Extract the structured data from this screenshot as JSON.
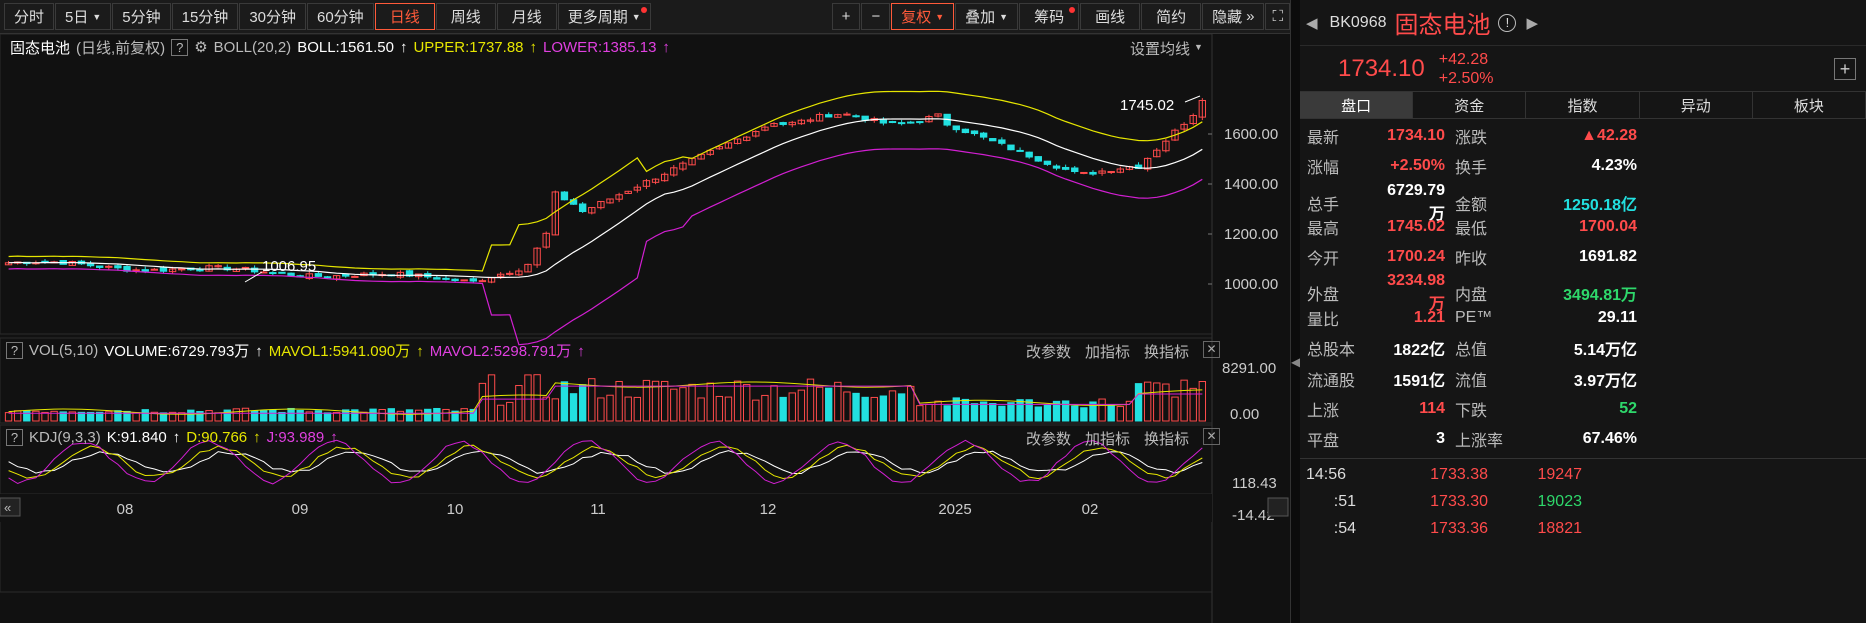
{
  "toolbar": {
    "periods": [
      "分时",
      "5日",
      "5分钟",
      "15分钟",
      "30分钟",
      "60分钟",
      "日线",
      "周线",
      "月线",
      "更多周期"
    ],
    "active_period": "日线",
    "tools": [
      "+",
      "−",
      "复权",
      "叠加",
      "筹码",
      "画线",
      "简约",
      "隐藏"
    ]
  },
  "boll": {
    "name": "固态电池",
    "sub": "(日线,前复权)",
    "indicator": "BOLL(20,2)",
    "mid": "BOLL:1561.50",
    "upper": "UPPER:1737.88",
    "lower": "LOWER:1385.13",
    "settings": "设置均线"
  },
  "price_axis": [
    "1600.00",
    "1400.00",
    "1200.00",
    "1000.00"
  ],
  "annotations": {
    "high": "1745.02",
    "low": "1006.95"
  },
  "vol": {
    "indicator": "VOL(5,10)",
    "volume": "VOLUME:6729.793万",
    "ma1": "MAVOL1:5941.090万",
    "ma2": "MAVOL2:5298.791万",
    "axis_top": "8291.00",
    "axis_bottom": "0.00"
  },
  "kdj": {
    "indicator": "KDJ(9,3,3)",
    "k": "K:91.840",
    "d": "D:90.766",
    "j": "J:93.989",
    "axis_top": "118.43",
    "axis_bottom": "-14.42"
  },
  "pane_links": [
    "改参数",
    "加指标",
    "换指标"
  ],
  "x_axis": [
    "08",
    "09",
    "10",
    "11",
    "12",
    "2025",
    "02"
  ],
  "quote": {
    "code": "BK0968",
    "name": "固态电池",
    "price": "1734.10",
    "change": "+42.28",
    "pct": "+2.50%",
    "tabs": [
      "盘口",
      "资金",
      "指数",
      "异动",
      "板块"
    ],
    "stats": [
      [
        "最新",
        "1734.10",
        "red",
        "涨跌",
        "▲42.28",
        "red"
      ],
      [
        "涨幅",
        "+2.50%",
        "red",
        "换手",
        "4.23%",
        "white"
      ],
      [
        "总手",
        "6729.79万",
        "white",
        "金额",
        "1250.18亿",
        "cyan"
      ],
      [
        "最高",
        "1745.02",
        "red",
        "最低",
        "1700.04",
        "red"
      ],
      [
        "今开",
        "1700.24",
        "red",
        "昨收",
        "1691.82",
        "white"
      ],
      [
        "外盘",
        "3234.98万",
        "red",
        "内盘",
        "3494.81万",
        "green"
      ],
      [
        "量比",
        "1.21",
        "red",
        "PE™",
        "29.11",
        "white"
      ],
      [
        "总股本",
        "1822亿",
        "white",
        "总值",
        "5.14万亿",
        "white"
      ],
      [
        "流通股",
        "1591亿",
        "white",
        "流值",
        "3.97万亿",
        "white"
      ],
      [
        "上涨",
        "114",
        "red",
        "下跌",
        "52",
        "green"
      ],
      [
        "平盘",
        "3",
        "white",
        "上涨率",
        "67.46%",
        "white"
      ]
    ],
    "ticks": [
      [
        "14:56",
        "1733.38",
        "19247",
        "red",
        "red"
      ],
      [
        ":51",
        "1733.30",
        "19023",
        "red",
        "green"
      ],
      [
        ":54",
        "1733.36",
        "18821",
        "red",
        "red"
      ]
    ]
  },
  "colors": {
    "up": "#ff4b4b",
    "down": "#22e0e0",
    "upper": "#e6e600",
    "lower": "#d21fd2",
    "mid": "#ffffff"
  }
}
